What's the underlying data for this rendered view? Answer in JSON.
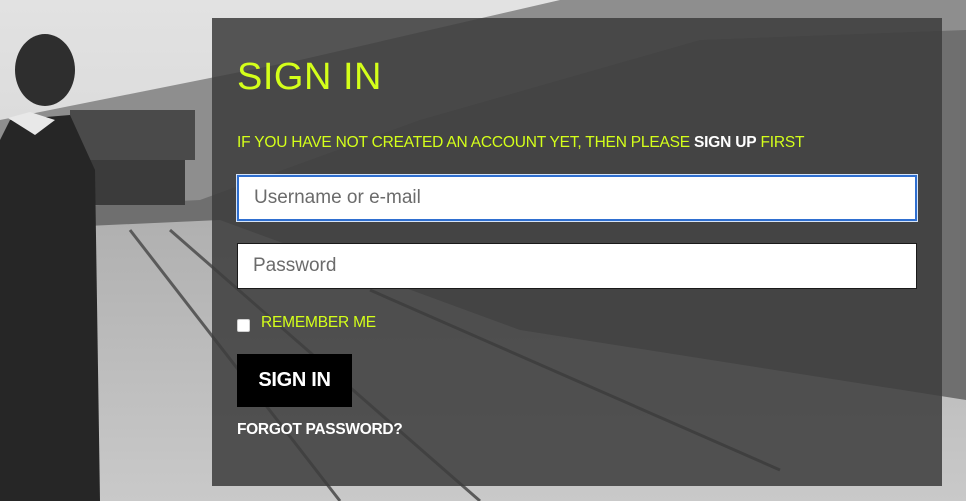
{
  "colors": {
    "accent": "#d4ff1a",
    "panel_background": "#3c3c3c",
    "button_background": "#000000",
    "input_focus_border": "#2f6fd0"
  },
  "background": {
    "description_icon": "background-photo"
  },
  "signin": {
    "title": "SIGN IN",
    "notice_prefix": "IF YOU HAVE NOT CREATED AN ACCOUNT YET, THEN PLEASE ",
    "signup_link": "SIGN UP",
    "notice_suffix": " FIRST",
    "username_placeholder": "Username or e-mail",
    "username_value": "",
    "password_placeholder": "Password",
    "password_value": "",
    "remember_label": "REMEMBER ME",
    "remember_checked": false,
    "submit_label": "SIGN IN",
    "forgot_label": "FORGOT PASSWORD?"
  }
}
